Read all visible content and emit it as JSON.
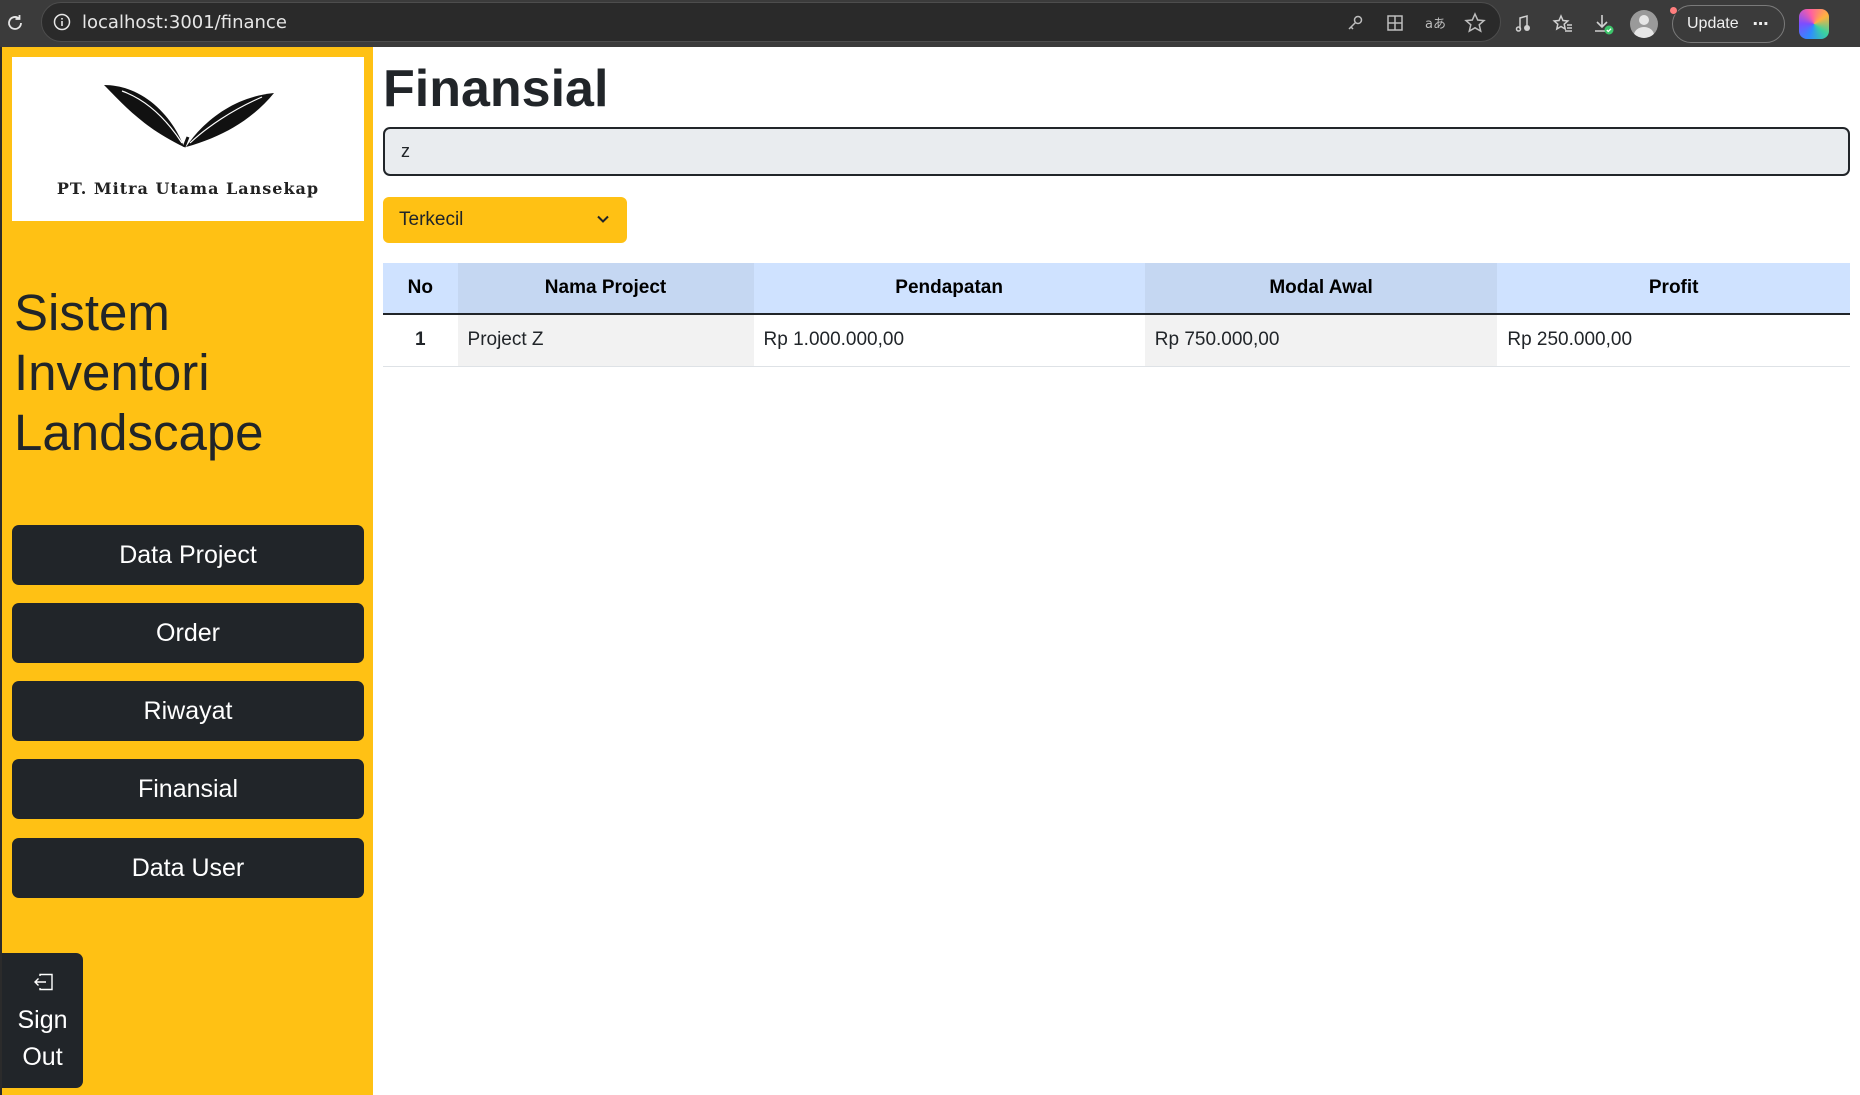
{
  "browser": {
    "url": "localhost:3001/finance",
    "update_label": "Update"
  },
  "sidebar": {
    "company_name": "PT. Mitra Utama Lansekap",
    "app_title": "Sistem Inventori Landscape",
    "nav": [
      {
        "label": "Data Project"
      },
      {
        "label": "Order"
      },
      {
        "label": "Riwayat"
      },
      {
        "label": "Finansial"
      },
      {
        "label": "Data User"
      }
    ],
    "signout_line1": "Sign",
    "signout_line2": "Out"
  },
  "main": {
    "title": "Finansial",
    "search_value": "z",
    "sort_selected": "Terkecil",
    "table": {
      "headers": [
        "No",
        "Nama Project",
        "Pendapatan",
        "Modal Awal",
        "Profit"
      ],
      "rows": [
        [
          "1",
          "Project Z",
          "Rp 1.000.000,00",
          "Rp 750.000,00",
          "Rp 250.000,00"
        ]
      ]
    }
  },
  "colors": {
    "sidebar_bg": "#ffc114",
    "nav_bg": "#212529",
    "table_header_bg": "#cfe2ff"
  }
}
